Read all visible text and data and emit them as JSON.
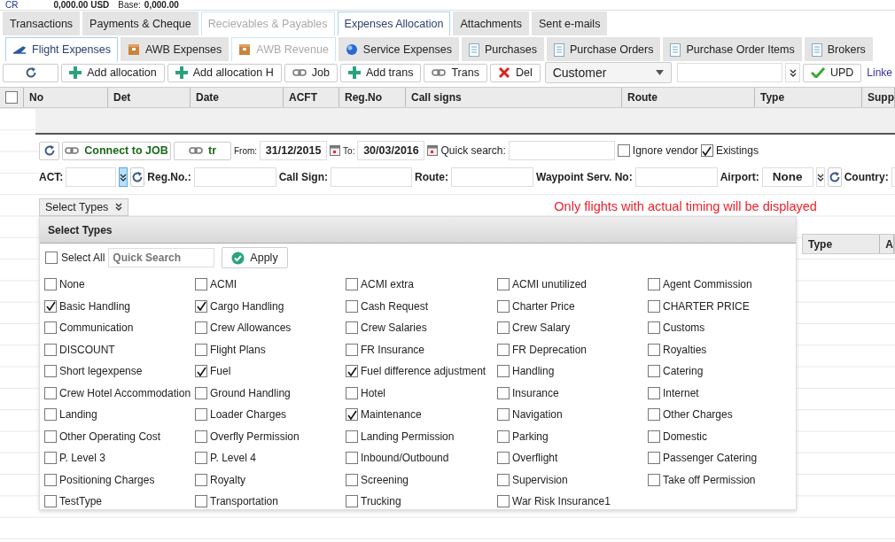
{
  "header": {
    "account": "CR",
    "amount": "0,000.00 USD",
    "base_label": "Base:",
    "base_value": "0,000.00"
  },
  "main_tabs": [
    {
      "label": "Transactions",
      "selected": false,
      "disabled": false
    },
    {
      "label": "Payments & Cheque",
      "selected": false,
      "disabled": false
    },
    {
      "label": "Recievables & Payables",
      "selected": false,
      "disabled": true
    },
    {
      "label": "Expenses Allocation",
      "selected": true,
      "disabled": false
    },
    {
      "label": "Attachments",
      "selected": false,
      "disabled": false
    },
    {
      "label": "Sent e-mails",
      "selected": false,
      "disabled": false
    }
  ],
  "sub_tabs": [
    {
      "label": "Flight Expenses",
      "selected": true,
      "disabled": false
    },
    {
      "label": "AWB Expenses",
      "selected": false,
      "disabled": false
    },
    {
      "label": "AWB Revenue",
      "selected": false,
      "disabled": true
    },
    {
      "label": "Service Expenses",
      "selected": false,
      "disabled": false
    },
    {
      "label": "Purchases",
      "selected": false,
      "disabled": false
    },
    {
      "label": "Purchase Orders",
      "selected": false,
      "disabled": false
    },
    {
      "label": "Purchase Order Items",
      "selected": false,
      "disabled": false
    },
    {
      "label": "Brokers",
      "selected": false,
      "disabled": false
    }
  ],
  "toolbar": {
    "buttons": [
      {
        "kind": "add",
        "label": "Add allocation"
      },
      {
        "kind": "add",
        "label": "Add allocation H"
      },
      {
        "kind": "link",
        "label": "Job"
      },
      {
        "kind": "add",
        "label": "Add trans"
      },
      {
        "kind": "link",
        "label": "Trans"
      },
      {
        "kind": "delete",
        "label": "Del"
      }
    ],
    "customer_select": "Customer",
    "update_button": "UPD",
    "linked_link": "Linke"
  },
  "grid": {
    "select_all": {
      "checked": false
    },
    "columns": [
      "No",
      "Det",
      "Date",
      "ACFT",
      "Reg.No",
      "Call signs",
      "Route",
      "Type",
      "Supp"
    ]
  },
  "filters": {
    "connect_button": "Connect to JOB",
    "tr_button": "tr",
    "from_label": "From:",
    "from_value": "31/12/2015",
    "to_label": "To:",
    "to_value": "30/03/2016",
    "quick_search_label": "Quick search:",
    "ignore_vendor": {
      "label": "Ignore vendor",
      "checked": false
    },
    "existings": {
      "label": "Existings",
      "checked": true
    },
    "act_label": "ACT:",
    "reg_label": "Reg.No.:",
    "call_sign_label": "Call Sign:",
    "route_label": "Route:",
    "waypoint_label": "Waypoint Serv. No:",
    "airport_label": "Airport:",
    "airport_value": "None",
    "country_label": "Country:"
  },
  "select_types_button": "Select Types",
  "message": "Only flights with actual timing will be displayed",
  "background_grid": {
    "column_1": "Type",
    "column_2": "A"
  },
  "select_types": {
    "title": "Select Types",
    "select_all": {
      "label": "Select All",
      "checked": false
    },
    "search_placeholder": "Quick Search",
    "apply": "Apply",
    "options": [
      {
        "label": "None",
        "checked": false
      },
      {
        "label": "ACMI",
        "checked": false
      },
      {
        "label": "ACMI extra",
        "checked": false
      },
      {
        "label": "ACMI unutilized",
        "checked": false
      },
      {
        "label": "Agent Commission",
        "checked": false
      },
      {
        "label": "Basic Handling",
        "checked": true
      },
      {
        "label": "Cargo Handling",
        "checked": true
      },
      {
        "label": "Cash Request",
        "checked": false
      },
      {
        "label": "Charter Price",
        "checked": false
      },
      {
        "label": "CHARTER PRICE",
        "checked": false
      },
      {
        "label": "Communication",
        "checked": false
      },
      {
        "label": "Crew Allowances",
        "checked": false
      },
      {
        "label": "Crew Salaries",
        "checked": false
      },
      {
        "label": "Crew Salary",
        "checked": false
      },
      {
        "label": "Customs",
        "checked": false
      },
      {
        "label": "DISCOUNT",
        "checked": false
      },
      {
        "label": "Flight Plans",
        "checked": false
      },
      {
        "label": "FR Insurance",
        "checked": false
      },
      {
        "label": "FR Deprecation",
        "checked": false
      },
      {
        "label": "Royalties",
        "checked": false
      },
      {
        "label": "Short legexpense",
        "checked": false
      },
      {
        "label": "Fuel",
        "checked": true
      },
      {
        "label": "Fuel difference adjustment",
        "checked": true
      },
      {
        "label": "Handling",
        "checked": false
      },
      {
        "label": "Catering",
        "checked": false
      },
      {
        "label": "Crew Hotel Accommodation",
        "checked": false
      },
      {
        "label": "Ground Handling",
        "checked": false
      },
      {
        "label": "Hotel",
        "checked": false
      },
      {
        "label": "Insurance",
        "checked": false
      },
      {
        "label": "Internet",
        "checked": false
      },
      {
        "label": "Landing",
        "checked": false
      },
      {
        "label": "Loader Charges",
        "checked": false
      },
      {
        "label": "Maintenance",
        "checked": true
      },
      {
        "label": "Navigation",
        "checked": false
      },
      {
        "label": "Other Charges",
        "checked": false
      },
      {
        "label": "Other Operating Cost",
        "checked": false
      },
      {
        "label": "Overfly Permission",
        "checked": false
      },
      {
        "label": "Landing Permission",
        "checked": false
      },
      {
        "label": "Parking",
        "checked": false
      },
      {
        "label": "Domestic",
        "checked": false
      },
      {
        "label": "P. Level 3",
        "checked": false
      },
      {
        "label": "P. Level 4",
        "checked": false
      },
      {
        "label": "Inbound/Outbound",
        "checked": false
      },
      {
        "label": "Overflight",
        "checked": false
      },
      {
        "label": "Passenger Catering",
        "checked": false
      },
      {
        "label": "Positioning Charges",
        "checked": false
      },
      {
        "label": "Royalty",
        "checked": false
      },
      {
        "label": "Screening",
        "checked": false
      },
      {
        "label": "Supervision",
        "checked": false
      },
      {
        "label": "Take off Permission",
        "checked": false
      },
      {
        "label": "TestType",
        "checked": false
      },
      {
        "label": "Transportation",
        "checked": false
      },
      {
        "label": "Trucking",
        "checked": false
      },
      {
        "label": "War Risk Insurance1",
        "checked": false
      }
    ]
  }
}
